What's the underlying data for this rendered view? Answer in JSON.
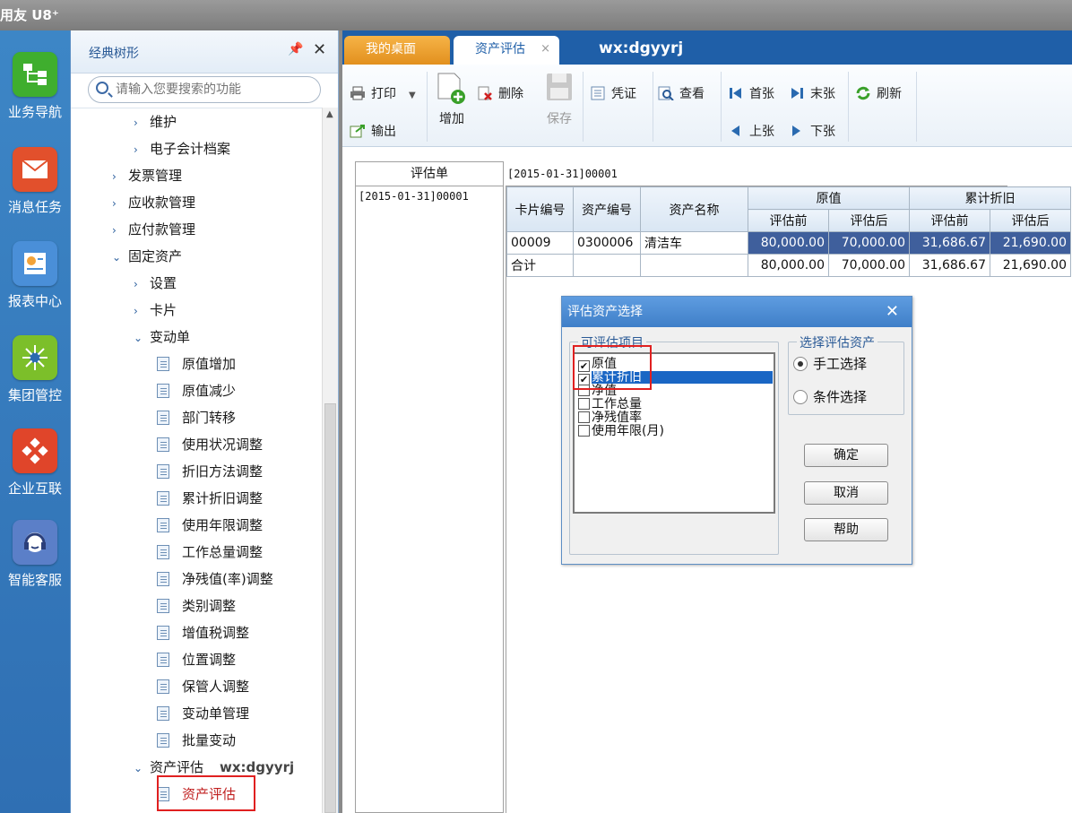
{
  "app": {
    "title": "用友 U8⁺"
  },
  "appbar": [
    {
      "label": "业务导航",
      "icon": "tree-icon",
      "color": "#3fae2e"
    },
    {
      "label": "消息任务",
      "icon": "envelope-icon",
      "color": "#e2502c"
    },
    {
      "label": "报表中心",
      "icon": "report-icon",
      "color": "#4a8fd8"
    },
    {
      "label": "集团管控",
      "icon": "network-icon",
      "color": "#7cbf2a"
    },
    {
      "label": "企业互联",
      "icon": "connect-icon",
      "color": "#e0452a"
    },
    {
      "label": "智能客服",
      "icon": "headset-icon",
      "color": "#5b7fc8"
    }
  ],
  "tree": {
    "title": "经典树形",
    "search_placeholder": "请输入您要搜索的功能",
    "items": [
      {
        "label": "维护",
        "arrow": "›"
      },
      {
        "label": "电子会计档案",
        "arrow": "›"
      },
      {
        "label": "发票管理",
        "arrow": "›"
      },
      {
        "label": "应收款管理",
        "arrow": "›"
      },
      {
        "label": "应付款管理",
        "arrow": "›"
      },
      {
        "label": "固定资产",
        "arrow": "⌄"
      },
      {
        "label": "设置",
        "arrow": "›"
      },
      {
        "label": "卡片",
        "arrow": "›"
      },
      {
        "label": "变动单",
        "arrow": "⌄"
      },
      {
        "label": "原值增加"
      },
      {
        "label": "原值减少"
      },
      {
        "label": "部门转移"
      },
      {
        "label": "使用状况调整"
      },
      {
        "label": "折旧方法调整"
      },
      {
        "label": "累计折旧调整"
      },
      {
        "label": "使用年限调整"
      },
      {
        "label": "工作总量调整"
      },
      {
        "label": "净残值(率)调整"
      },
      {
        "label": "类别调整"
      },
      {
        "label": "增值税调整"
      },
      {
        "label": "位置调整"
      },
      {
        "label": "保管人调整"
      },
      {
        "label": "变动单管理"
      },
      {
        "label": "批量变动"
      },
      {
        "label": "资产评估",
        "arrow": "⌄"
      },
      {
        "label": "资产评估"
      }
    ],
    "watermark": "wx:dgyyrj"
  },
  "tabs": {
    "desk": "我的桌面",
    "eval": "资产评估",
    "close": "×",
    "watermark": "wx:dgyyrj"
  },
  "toolbar": {
    "print": "打印",
    "export": "输出",
    "add": "增加",
    "delete": "删除",
    "save": "保存",
    "voucher": "凭证",
    "view": "查看",
    "first": "首张",
    "last": "末张",
    "prev": "上张",
    "next": "下张",
    "refresh": "刷新"
  },
  "bill": {
    "header": "评估单",
    "row": "[2015-01-31]00001",
    "title": "[2015-01-31]00001"
  },
  "grid": {
    "headers": {
      "card": "卡片编号",
      "asset": "资产编号",
      "name": "资产名称",
      "orig": "原值",
      "dep": "累计折旧",
      "before": "评估前",
      "after": "评估后"
    },
    "rows": [
      [
        "00009",
        "0300006",
        "清洁车",
        "80,000.00",
        "70,000.00",
        "31,686.67",
        "21,690.00"
      ],
      [
        "合计",
        "",
        "",
        "80,000.00",
        "70,000.00",
        "31,686.67",
        "21,690.00"
      ]
    ]
  },
  "dialog": {
    "title": "评估资产选择",
    "group_items": "可评估项目",
    "group_select": "选择评估资产",
    "items": [
      {
        "label": "原值",
        "checked": true
      },
      {
        "label": "累计折旧",
        "checked": true
      },
      {
        "label": "净值",
        "checked": false
      },
      {
        "label": "工作总量",
        "checked": false
      },
      {
        "label": "净残值率",
        "checked": false
      },
      {
        "label": "使用年限(月)",
        "checked": false
      }
    ],
    "radio_manual": "手工选择",
    "radio_cond": "条件选择",
    "ok": "确定",
    "cancel": "取消",
    "help": "帮助"
  }
}
